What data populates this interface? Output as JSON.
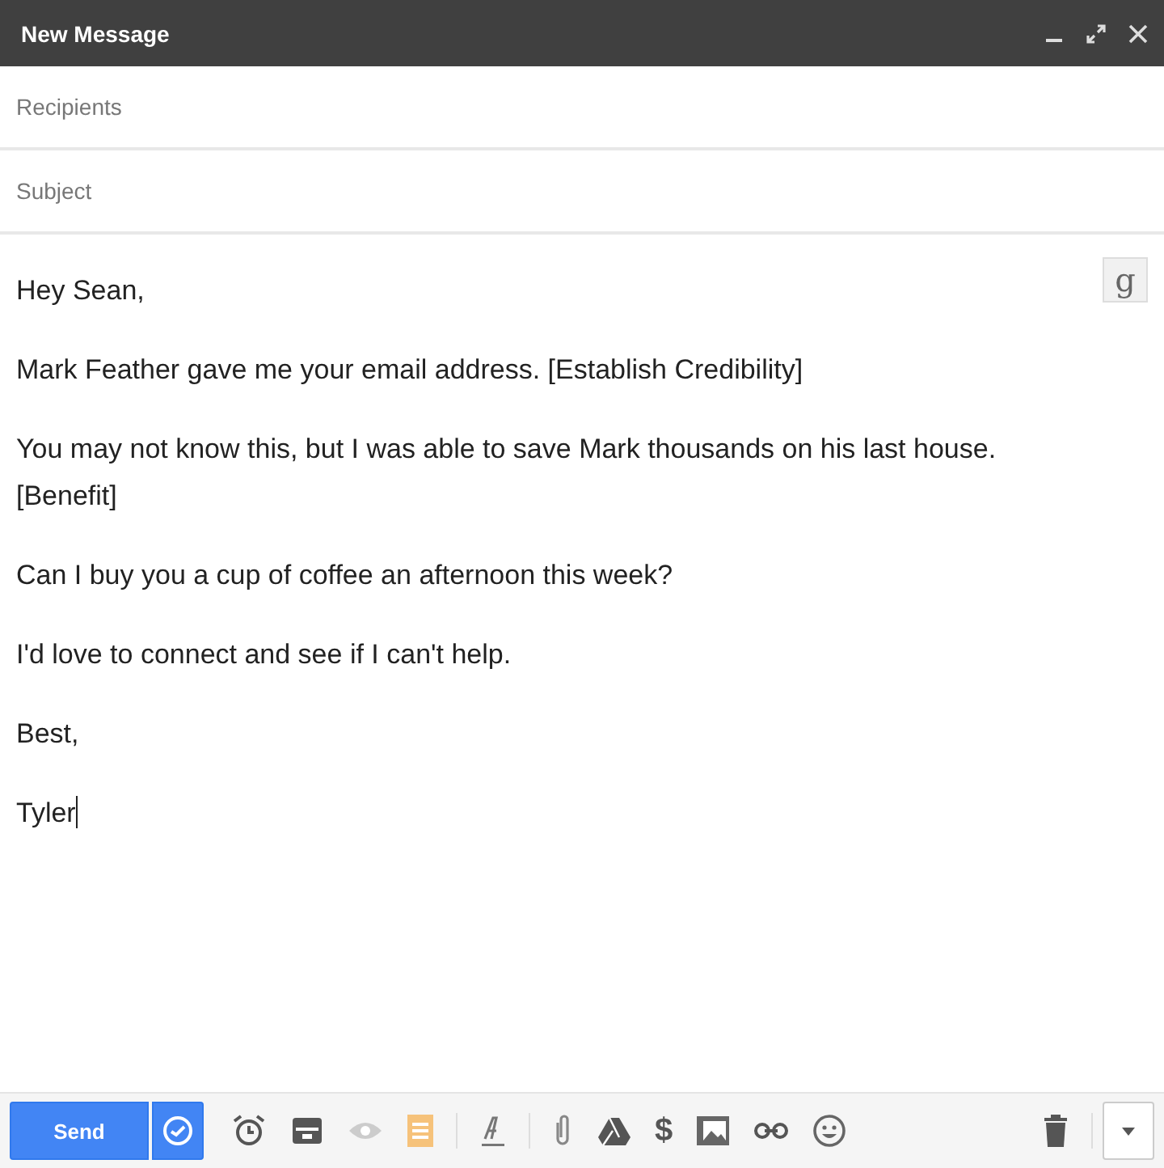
{
  "window": {
    "title": "New Message"
  },
  "fields": [
    {
      "placeholder": "Recipients"
    },
    {
      "placeholder": "Subject"
    }
  ],
  "body": {
    "badge": "g",
    "paragraphs": [
      "Hey Sean,",
      "Mark Feather gave me your email address. [Establish Credibility]",
      "You may not know this, but I was able to save Mark thousands on his last house. [Benefit]",
      "Can I buy you a cup of coffee an afternoon this week?",
      "I'd love to connect and see if I can't help.",
      "Best,",
      "Tyler"
    ]
  },
  "toolbar": {
    "send": "Send",
    "dollar": "$"
  }
}
